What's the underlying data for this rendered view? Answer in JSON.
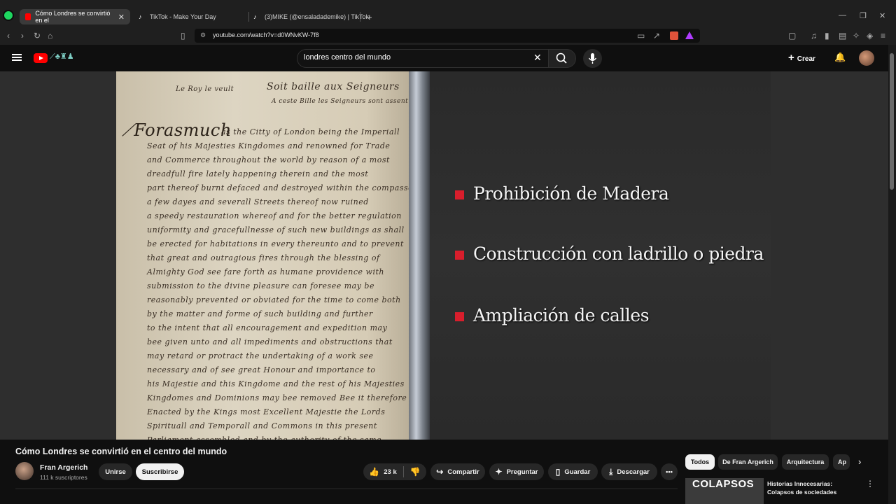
{
  "browser": {
    "tabs": [
      {
        "title": "Cómo Londres se convirtió en el",
        "favicon": "youtube-icon",
        "active": true
      },
      {
        "title": "TikTok - Make Your Day",
        "favicon": "tiktok-icon",
        "active": false
      },
      {
        "title": "(3)MIKE (@ensaladademike) | TikTok",
        "favicon": "tiktok-icon",
        "active": false
      }
    ],
    "new_tab": "+",
    "url": "youtube.com/watch?v=d0WNvKW-7f8"
  },
  "header": {
    "search_query": "londres centro del mundo",
    "create_label": "Crear"
  },
  "video": {
    "slide_bullets": [
      "Prohibición de Madera",
      "Construcción con ladrillo o piedra",
      "Ampliación de calles"
    ],
    "accent_color": "#d81e2c"
  },
  "info": {
    "title": "Cómo Londres se convirtió en el centro del mundo",
    "channel_name": "Fran Argerich",
    "subscribers": "111 k suscriptores",
    "join_label": "Unirse",
    "subscribe_label": "Suscribirse",
    "likes": "23 k",
    "share_label": "Compartir",
    "ask_label": "Preguntar",
    "save_label": "Guardar",
    "download_label": "Descargar"
  },
  "chips": [
    "Todos",
    "De Fran Argerich",
    "Arquitectura",
    "Ap"
  ],
  "recommendation": {
    "thumb_text": "COLAPSOS",
    "title": "Historias Innecesarias: Colapsos de sociedades"
  }
}
